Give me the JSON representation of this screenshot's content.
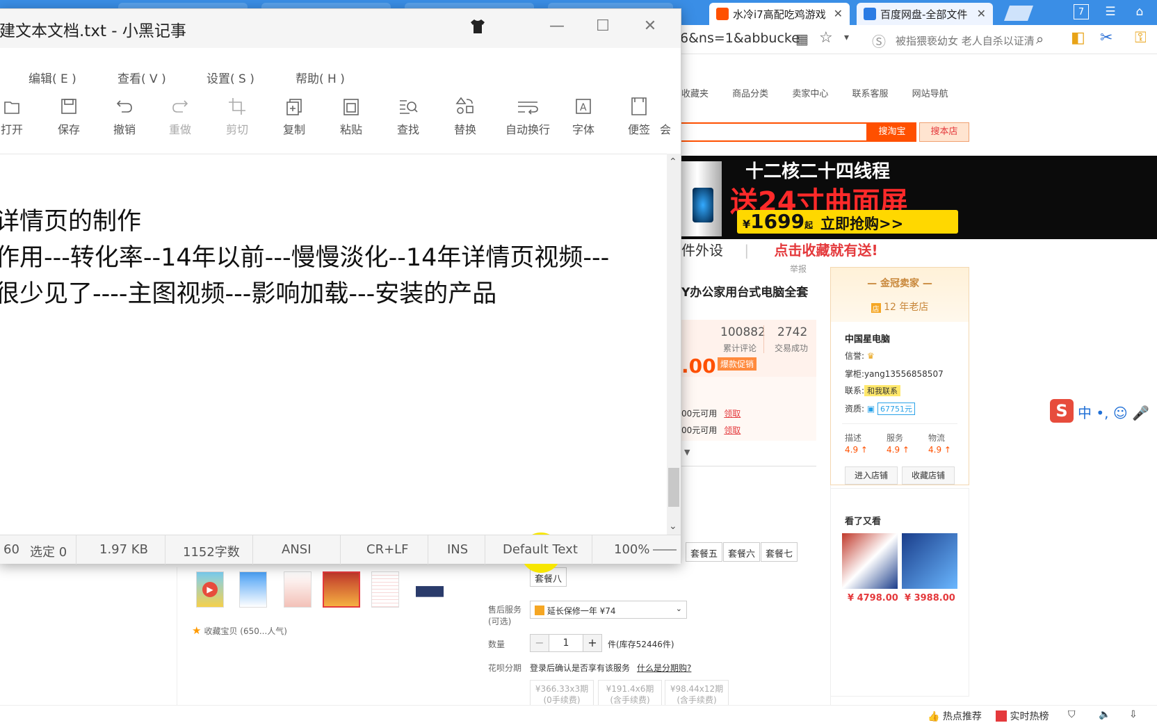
{
  "browser": {
    "tabs": [
      {
        "label": "水冷i7高配吃鸡游戏",
        "active": true
      },
      {
        "label": "百度网盘-全部文件",
        "active": false
      }
    ],
    "tab_count_badge": "7",
    "url_fragment": "6&ns=1&abbucke",
    "search_placeholder": "被指猥亵幼女 老人自杀以证清白",
    "nav": [
      "收藏夹",
      "商品分类",
      "卖家中心",
      "联系客服",
      "网站导航"
    ],
    "search_btn_main": "搜淘宝",
    "search_btn_store": "搜本店",
    "banner": {
      "line1": "十二核二十四线程",
      "line2": "送24寸曲面屏",
      "price_prefix": "¥",
      "price": "1699",
      "price_suffix": "起",
      "cta": "立即抢购>>"
    },
    "category_row": {
      "left": "件外设",
      "sep": "|",
      "promo": "点击收藏就有送!"
    },
    "report": "举报",
    "product_title": "Y办公家用台式电脑全套",
    "stats": {
      "reviews_value": "100882",
      "reviews_label": "累计评论",
      "deals_value": "2742",
      "deals_label": "交易成功"
    },
    "price_fragment": ".00",
    "promo_tag": "爆款促销",
    "coupons": [
      {
        "text": "00元可用",
        "link": "领取"
      },
      {
        "text": "00元可用",
        "link": "领取"
      }
    ],
    "seller": {
      "title": "金冠卖家",
      "age": "12 年老店",
      "name": "中国星电脑",
      "credit_label": "信誉:",
      "owner_label": "掌柜:",
      "owner": "yang13556858507",
      "contact_label": "联系:",
      "contact_badge": "和我联系",
      "fund_label": "资质:",
      "fund_value": "67751元",
      "scores": [
        {
          "label": "描述",
          "value": "4.9 ↑"
        },
        {
          "label": "服务",
          "value": "4.9 ↑"
        },
        {
          "label": "物流",
          "value": "4.9 ↑"
        }
      ],
      "enter_store": "进入店铺",
      "fav_store": "收藏店铺"
    },
    "see_also": {
      "title": "看了又看",
      "items": [
        {
          "price": "¥ 4798.00"
        },
        {
          "price": "¥ 3988.00"
        }
      ]
    },
    "packages": [
      "套餐五",
      "套餐六",
      "套餐七",
      "套餐八"
    ],
    "fav_line": "收藏宝贝 (650...人气)",
    "after_sales_label": "售后服务",
    "after_sales_sub": "(可选)",
    "after_sales_value": "延长保修一年 ¥74",
    "qty_label": "数量",
    "qty_value": "1",
    "stock_text": "件(库存52446件)",
    "installment_label": "花呗分期",
    "installment_text": "登录后确认是否享有该服务",
    "installment_link": "什么是分期购?",
    "installments": [
      {
        "line1": "¥366.33x3期",
        "line2": "(0手续费)"
      },
      {
        "line1": "¥191.4x6期",
        "line2": "(含手续费)"
      },
      {
        "line1": "¥98.44x12期",
        "line2": "(含手续费)"
      }
    ],
    "ime": {
      "logo": "S",
      "text": "中 •, ☺ 🎤"
    },
    "status_bar": {
      "hot": "热点推荐",
      "realtime": "实时热榜"
    }
  },
  "notepad": {
    "title": "建文本文档.txt - 小黑记事",
    "menu": [
      "编辑( E )",
      "查看( V )",
      "设置( S )",
      "帮助( H )"
    ],
    "toolbar": [
      {
        "label": "打开",
        "icon": "folder-open-icon"
      },
      {
        "label": "保存",
        "icon": "save-icon"
      },
      {
        "label": "撤销",
        "icon": "undo-icon"
      },
      {
        "label": "重做",
        "icon": "redo-icon",
        "disabled": true
      },
      {
        "label": "剪切",
        "icon": "cut-icon",
        "disabled": true
      },
      {
        "label": "复制",
        "icon": "copy-icon"
      },
      {
        "label": "粘贴",
        "icon": "paste-icon"
      },
      {
        "label": "查找",
        "icon": "find-icon"
      },
      {
        "label": "替换",
        "icon": "replace-icon"
      },
      {
        "label": "自动换行",
        "icon": "word-wrap-icon"
      },
      {
        "label": "字体",
        "icon": "font-icon"
      },
      {
        "label": "便签",
        "icon": "note-icon"
      },
      {
        "label": "会",
        "icon": "more-icon"
      }
    ],
    "lines": [
      "详情页的制作",
      "作用---转化率--14年以前---慢慢淡化--14年详情页视频---",
      "很少见了----主图视频---影响加载---安装的产品"
    ],
    "status": {
      "position": "60",
      "selection": "选定 0",
      "size": "1.97 KB",
      "chars": "1152字数",
      "encoding": "ANSI",
      "eol": "CR+LF",
      "mode": "INS",
      "style": "Default Text",
      "zoom": "100%"
    }
  }
}
